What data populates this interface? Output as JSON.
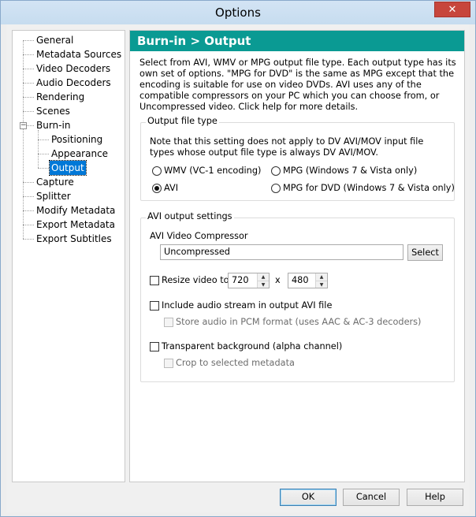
{
  "window": {
    "title": "Options",
    "close_glyph": "✕"
  },
  "tree": {
    "items": [
      {
        "label": "General",
        "level": 0
      },
      {
        "label": "Metadata Sources",
        "level": 0
      },
      {
        "label": "Video Decoders",
        "level": 0
      },
      {
        "label": "Audio Decoders",
        "level": 0
      },
      {
        "label": "Rendering",
        "level": 0
      },
      {
        "label": "Scenes",
        "level": 0
      },
      {
        "label": "Burn-in",
        "level": 0,
        "expanded": true
      },
      {
        "label": "Positioning",
        "level": 1
      },
      {
        "label": "Appearance",
        "level": 1
      },
      {
        "label": "Output",
        "level": 1,
        "selected": true
      },
      {
        "label": "Capture",
        "level": 0
      },
      {
        "label": "Splitter",
        "level": 0
      },
      {
        "label": "Modify Metadata",
        "level": 0
      },
      {
        "label": "Export Metadata",
        "level": 0
      },
      {
        "label": "Export Subtitles",
        "level": 0
      }
    ]
  },
  "panel": {
    "header": "Burn-in  >  Output",
    "intro": "Select from AVI, WMV or MPG output file type. Each output type has its own set of options. \"MPG for DVD\" is the same as MPG except that the encoding is suitable for use on video DVDs. AVI uses any of the compatible compressors on your PC which you can choose from, or Uncompressed video. Click help for more details.",
    "output_type": {
      "title": "Output file type",
      "note": "Note that this setting does not apply to DV AVI/MOV input file types whose output file type is always DV AVI/MOV.",
      "options": [
        {
          "label": "WMV (VC-1 encoding)",
          "selected": false
        },
        {
          "label": "MPG (Windows 7 & Vista only)",
          "selected": false
        },
        {
          "label": "AVI",
          "selected": true
        },
        {
          "label": "MPG for DVD (Windows 7 & Vista only)",
          "selected": false
        }
      ]
    },
    "avi_settings": {
      "title": "AVI output settings",
      "compressor_label": "AVI Video Compressor",
      "compressor_value": "Uncompressed",
      "select_label": "Select",
      "resize_label": "Resize video to",
      "resize_checked": false,
      "width": "720",
      "by": "x",
      "height": "480",
      "include_audio_label": "Include audio stream in output AVI file",
      "include_audio_checked": false,
      "pcm_label": "Store audio in PCM format (uses AAC & AC-3 decoders)",
      "pcm_checked": false,
      "transparent_label": "Transparent background (alpha channel)",
      "transparent_checked": false,
      "crop_label": "Crop to selected metadata",
      "crop_checked": false
    }
  },
  "buttons": {
    "ok": "OK",
    "cancel": "Cancel",
    "help": "Help"
  },
  "icons": {
    "spin_up": "▲",
    "spin_down": "▼",
    "collapse": "−"
  }
}
